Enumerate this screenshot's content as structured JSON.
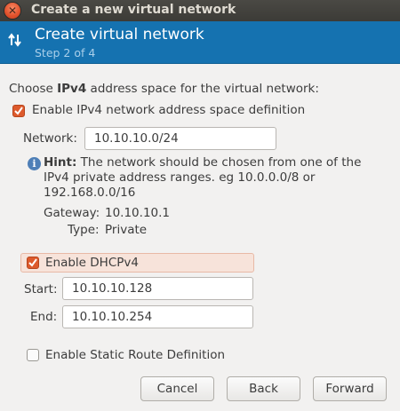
{
  "window": {
    "title": "Create a new virtual network"
  },
  "header": {
    "title": "Create virtual network",
    "step": "Step 2 of 4"
  },
  "form": {
    "intro_prefix": "Choose ",
    "intro_bold": "IPv4",
    "intro_suffix": " address space for the virtual network:",
    "enable_ipv4_label": "Enable IPv4 network address space definition",
    "enable_ipv4_checked": true,
    "network_label": "Network:",
    "network_value": "10.10.10.0/24",
    "hint_bold": "Hint:",
    "hint_line1": " The network should be chosen from one of the",
    "hint_line2": "IPv4 private address ranges. eg 10.0.0.0/8 or",
    "hint_line3": "192.168.0.0/16",
    "gateway_label": "Gateway:",
    "gateway_value": "10.10.10.1",
    "type_label": "Type:",
    "type_value": "Private",
    "dhcp_label": "Enable DHCPv4",
    "dhcp_checked": true,
    "start_label": "Start:",
    "start_value": "10.10.10.128",
    "end_label": "End:",
    "end_value": "10.10.10.254",
    "static_route_label": "Enable Static Route Definition",
    "static_route_checked": false
  },
  "buttons": {
    "cancel": "Cancel",
    "back": "Back",
    "forward": "Forward"
  },
  "icons": {
    "close": "close-icon",
    "wizard": "swap-arrows-icon",
    "info": "info-icon",
    "check": "checkmark-icon"
  },
  "colors": {
    "header_bg": "#1572b0",
    "accent": "#dd5a2c",
    "titlebar": "#3c3b37"
  }
}
